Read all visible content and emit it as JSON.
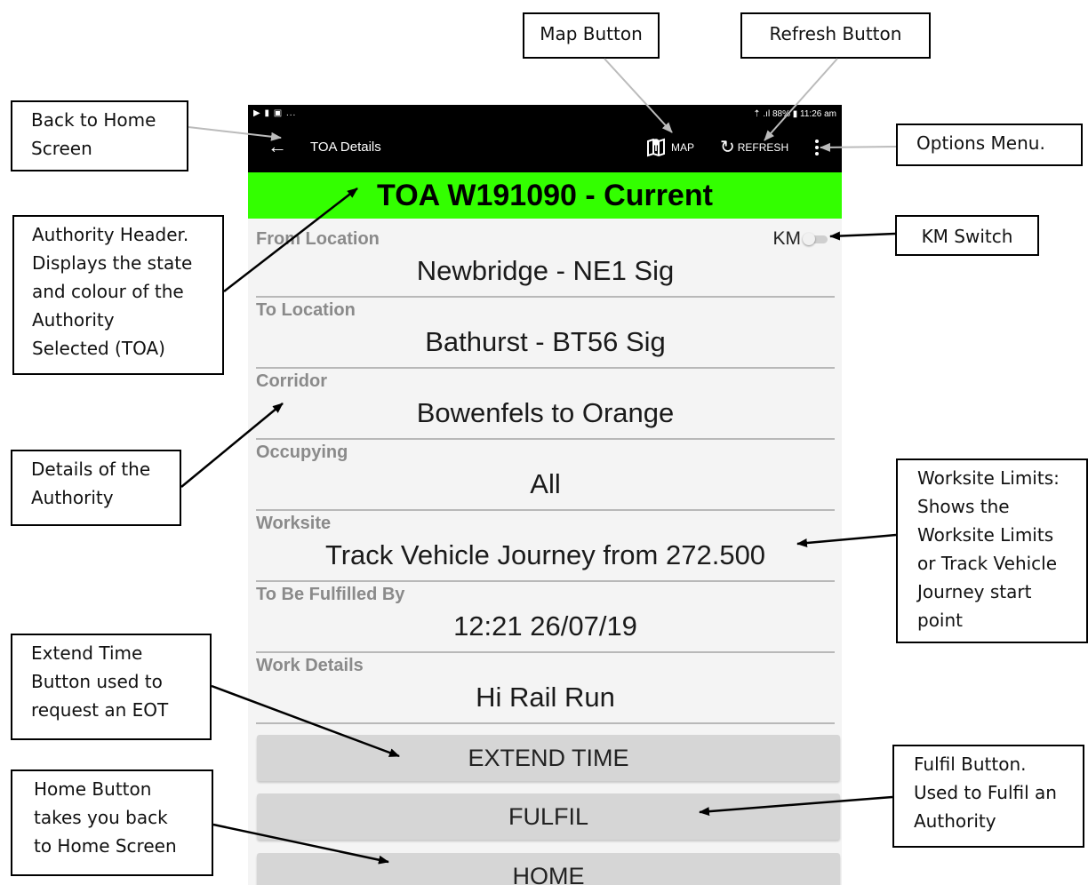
{
  "phone": {
    "status_left": "▶ ▮ ▣ ...",
    "status_right": "⇡ .ıl 88% ▮ 11:26 am",
    "title": "TOA Details",
    "map_label": "MAP",
    "refresh_label": "REFRESH",
    "authority_header": "TOA W191090 - Current",
    "authority_color": "#33ff00",
    "km_label": "KM",
    "fields": [
      {
        "label": "From Location",
        "value": "Newbridge - NE1 Sig"
      },
      {
        "label": "To Location",
        "value": "Bathurst - BT56 Sig"
      },
      {
        "label": "Corridor",
        "value": "Bowenfels to Orange"
      },
      {
        "label": "Occupying",
        "value": "All"
      },
      {
        "label": "Worksite",
        "value": "Track Vehicle Journey from 272.500"
      },
      {
        "label": "To Be Fulfilled By",
        "value": "12:21 26/07/19"
      },
      {
        "label": "Work Details",
        "value": "Hi Rail Run"
      }
    ],
    "buttons": {
      "extend": "EXTEND TIME",
      "fulfil": "FULFIL",
      "home": "HOME"
    }
  },
  "callouts": {
    "map_button": "Map Button",
    "refresh_button": "Refresh Button",
    "back": "Back to Home\nScreen",
    "options": "Options Menu.",
    "authority_header": "Authority Header.\nDisplays the state\nand colour of the\nAuthority\nSelected (TOA)",
    "km_switch": "KM Switch",
    "details": "Details of the\nAuthority",
    "worksite": "Worksite Limits:\nShows the\nWorksite Limits\nor Track Vehicle\nJourney start\npoint",
    "extend_time": "Extend Time\nButton used to\nrequest an EOT",
    "fulfil": "Fulfil Button.\nUsed to Fulfil an\nAuthority",
    "home": "Home Button\ntakes you back\nto Home Screen"
  }
}
